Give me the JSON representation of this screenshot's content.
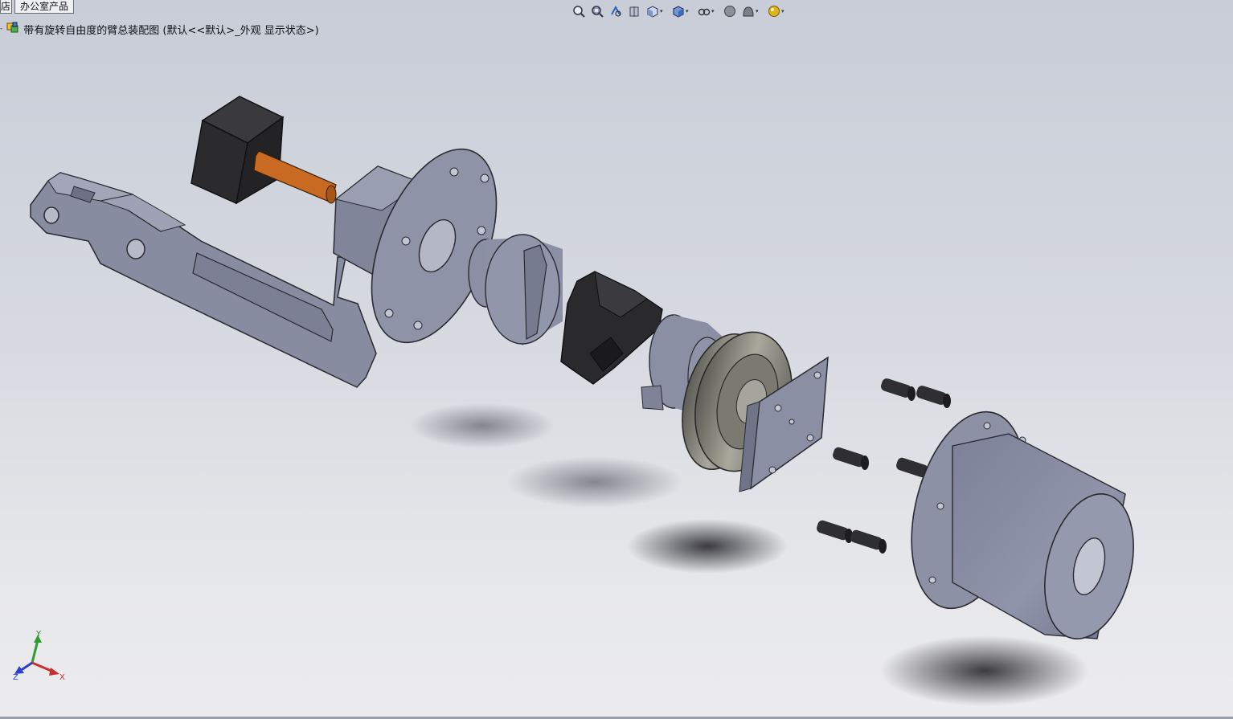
{
  "document_tabs": [
    "店",
    "办公室产品"
  ],
  "feature_tree": {
    "root_label": "带有旋转自由度的臂总装配图  (默认<<默认>_外观 显示状态>)"
  },
  "toolbar": {
    "buttons": [
      {
        "icon": "zoom-to-fit-icon",
        "dropdown": false
      },
      {
        "icon": "zoom-to-area-icon",
        "dropdown": false
      },
      {
        "icon": "previous-view-icon",
        "dropdown": false
      },
      {
        "icon": "section-view-icon",
        "dropdown": false
      },
      {
        "icon": "view-orientation-icon",
        "dropdown": true
      },
      {
        "icon": "display-style-icon",
        "dropdown": true
      },
      {
        "icon": "hide-show-items-icon",
        "dropdown": true
      },
      {
        "icon": "edit-appearance-icon",
        "dropdown": false
      },
      {
        "icon": "apply-scene-icon",
        "dropdown": true
      },
      {
        "icon": "view-settings-icon",
        "dropdown": true
      }
    ]
  },
  "triad": {
    "x_label": "X",
    "y_label": "Y",
    "z_label": "Z"
  },
  "colors": {
    "part_steel": "#8c91a5",
    "part_dark": "#2d2d2f",
    "part_orange": "#c86a22",
    "background_top": "#c8cdd8",
    "background_bottom": "#ececee"
  }
}
